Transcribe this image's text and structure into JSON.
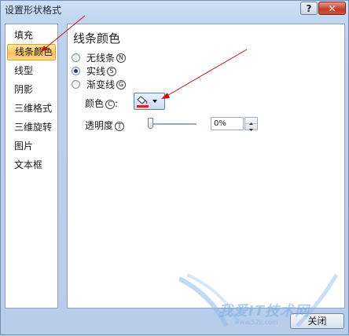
{
  "dialog": {
    "title": "设置形状格式",
    "help_button": "?",
    "close_x": "✕"
  },
  "sidebar": {
    "items": [
      {
        "label": "填充"
      },
      {
        "label": "线条颜色",
        "selected": true
      },
      {
        "label": "线型"
      },
      {
        "label": "阴影"
      },
      {
        "label": "三维格式"
      },
      {
        "label": "三维旋转"
      },
      {
        "label": "图片"
      },
      {
        "label": "文本框"
      }
    ]
  },
  "panel": {
    "title": "线条颜色",
    "options": [
      {
        "label": "无线条",
        "accel": "N",
        "selected": false
      },
      {
        "label": "实线",
        "accel": "S",
        "selected": true
      },
      {
        "label": "渐变线",
        "accel": "G",
        "selected": false
      }
    ],
    "color_label": "颜色",
    "color_accel": "C",
    "color_colon": ":",
    "line_color": "#e02020",
    "color_picker_icon": "paint-bucket-icon",
    "transparency_label": "透明度",
    "transparency_accel": "T",
    "transparency_value": "0%",
    "transparency_level": 0
  },
  "footer": {
    "close_label": "关闭"
  },
  "watermark": {
    "text": "我爱IT技术网",
    "sub": "www.52ij.com"
  },
  "colors": {
    "annotation_arrow": "#cc1010",
    "selection": "#f8c25a"
  }
}
